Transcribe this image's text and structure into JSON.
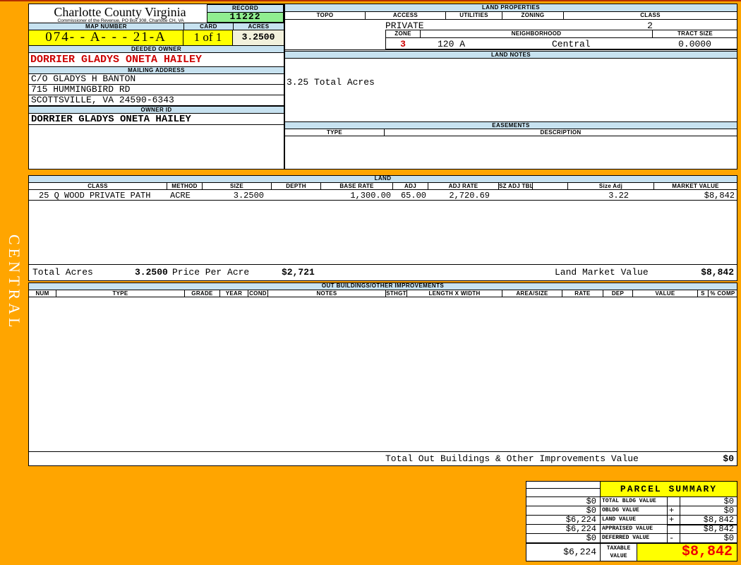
{
  "colors": {
    "page_orange": "#FFA500",
    "bar_blue": "#C7E2F0",
    "record_green": "#90EE90",
    "highlight_yellow": "#FFFF00",
    "acres_beige": "#F2F1DC",
    "owner_red": "#CC0000",
    "taxable_red": "#EE0000"
  },
  "district": "CENTRAL",
  "header": {
    "county_title": "Charlotte County Virginia",
    "commissioner_line": "Commissioner of the Revenue, PO Box 308, Charlotte CH, VA",
    "record_label": "RECORD",
    "record_value": "11222",
    "map_number_label": "MAP NUMBER",
    "map_number_value": "074- - A- - - 21-A",
    "card_label": "CARD",
    "card_value": "1 of 1",
    "acres_label": "ACRES",
    "acres_value": "3.2500"
  },
  "owner": {
    "deeded_owner_label": "DEEDED OWNER",
    "deeded_owner": "DORRIER GLADYS ONETA HAILEY",
    "mailing_address_label": "MAILING ADDRESS",
    "address_lines": [
      "C/O GLADYS H BANTON",
      "715 HUMMINGBIRD RD",
      "SCOTTSVILLE, VA 24590-6343"
    ],
    "owner_id_label": "OWNER ID",
    "owner_id": "DORRIER GLADYS ONETA HAILEY"
  },
  "land_properties": {
    "title": "LAND PROPERTIES",
    "columns": [
      "TOPO",
      "ACCESS",
      "UTILITIES",
      "ZONING",
      "CLASS"
    ],
    "topo": "",
    "access": "PRIVATE",
    "utilities": "",
    "zoning": "",
    "class": "2",
    "zone_label": "ZONE",
    "zone": "3",
    "neighborhood_label": "NEIGHBORHOOD",
    "neighborhood_code": "120 A",
    "neighborhood_name": "Central",
    "tract_size_label": "TRACT SIZE",
    "tract_size": "0.0000"
  },
  "land_notes": {
    "title": "LAND NOTES",
    "note": "3.25 Total Acres"
  },
  "easements": {
    "title": "EASEMENTS",
    "type_label": "TYPE",
    "description_label": "DESCRIPTION"
  },
  "land": {
    "title": "LAND",
    "columns": [
      "CLASS",
      "METHOD",
      "SIZE",
      "DEPTH",
      "BASE RATE",
      "ADJ",
      "ADJ RATE",
      "SZ ADJ TBL",
      "",
      "Size Adj",
      "MARKET VALUE"
    ],
    "rows": [
      [
        "25 Q WOOD PRIVATE PATH",
        "ACRE",
        "3.2500",
        "",
        "1,300.00",
        "65.00",
        "2,720.69",
        "",
        "",
        "3.22",
        "$8,842"
      ]
    ],
    "total_acres_label": "Total Acres",
    "total_acres": "3.2500",
    "price_per_acre_label": "Price Per Acre",
    "price_per_acre": "$2,721",
    "land_market_value_label": "Land Market Value",
    "land_market_value": "$8,842"
  },
  "out_buildings": {
    "title": "OUT BUILDINGS/OTHER IMPROVEMENTS",
    "columns": [
      "NUM",
      "TYPE",
      "GRADE",
      "YEAR",
      "COND",
      "NOTES",
      "STHGT",
      "LENGTH X WIDTH",
      "AREA/SIZE",
      "RATE",
      "DEP",
      "VALUE",
      "S",
      "% COMP"
    ],
    "total_label": "Total Out Buildings & Other Improvements Value",
    "total_value": "$0"
  },
  "parcel_summary": {
    "title": "PARCEL SUMMARY",
    "rows": [
      {
        "prior": "$0",
        "label": "TOTAL BLDG VALUE",
        "op": "",
        "value": "$0"
      },
      {
        "prior": "$0",
        "label": "OBLDG VALUE",
        "op": "+",
        "value": "$0"
      },
      {
        "prior": "$6,224",
        "label": "LAND VALUE",
        "op": "+",
        "value": "$8,842"
      },
      {
        "prior": "$6,224",
        "label": "APPRAISED VALUE",
        "op": "",
        "value": "$8,842"
      },
      {
        "prior": "$0",
        "label": "DEFERRED VALUE",
        "op": "-",
        "value": "$0"
      }
    ],
    "taxable": {
      "prior": "$6,224",
      "label": "TAXABLE VALUE",
      "value": "$8,842"
    }
  }
}
